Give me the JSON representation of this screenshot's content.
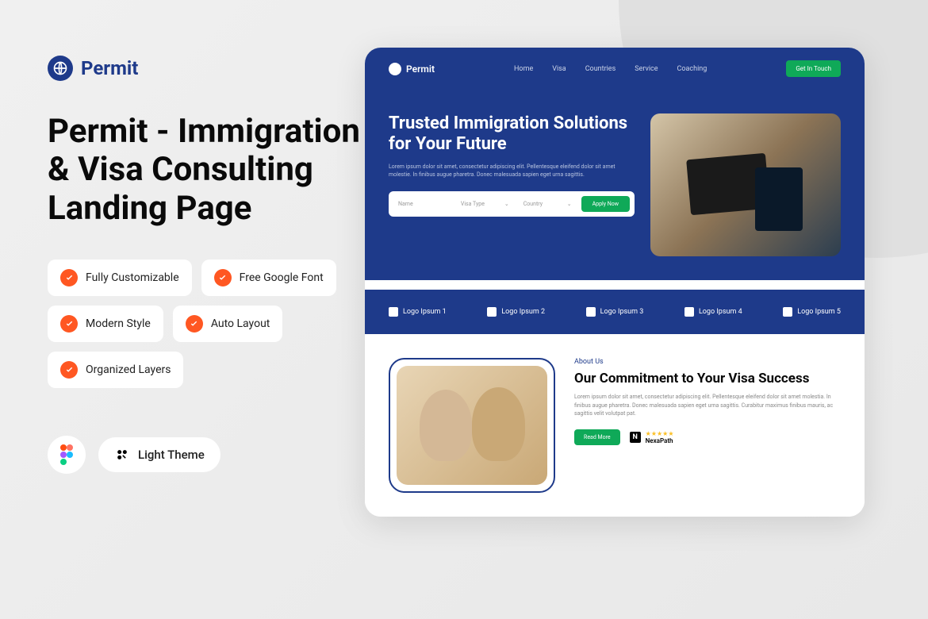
{
  "brand": {
    "name": "Permit"
  },
  "headline": "Permit - Immigration & Visa Consulting Landing Page",
  "features": [
    "Fully Customizable",
    "Free Google Font",
    "Modern Style",
    "Auto Layout",
    "Organized Layers"
  ],
  "theme": "Light Theme",
  "preview": {
    "nav": {
      "links": [
        "Home",
        "Visa",
        "Countries",
        "Service",
        "Coaching"
      ],
      "cta": "Get In Touch"
    },
    "hero": {
      "title": "Trusted Immigration Solutions for Your Future",
      "desc": "Lorem ipsum dolor sit amet, consectetur adipiscing elit. Pellentesque eleifend dolor sit amet molestie. In finibus augue pharetra. Donec malesuada sapien eget urna sagittis.",
      "search": {
        "name": "Name",
        "visa": "Visa Type",
        "country": "Country",
        "btn": "Apply Now"
      }
    },
    "logos": [
      "Logo Ipsum 1",
      "Logo Ipsum 2",
      "Logo Ipsum 3",
      "Logo Ipsum 4",
      "Logo Ipsum 5"
    ],
    "about": {
      "label": "About Us",
      "title": "Our Commitment to Your Visa Success",
      "desc": "Lorem ipsum dolor sit amet, consectetur adipiscing elit. Pellentesque eleifend dolor sit amet molestia. In finibus augue pharetra. Donec malesuada sapien eget urna sagittis. Curabitur maximus finibus mauris, ac sagittis velit volutpat pat.",
      "btn": "Read More",
      "nexa": "NexaPath"
    }
  }
}
